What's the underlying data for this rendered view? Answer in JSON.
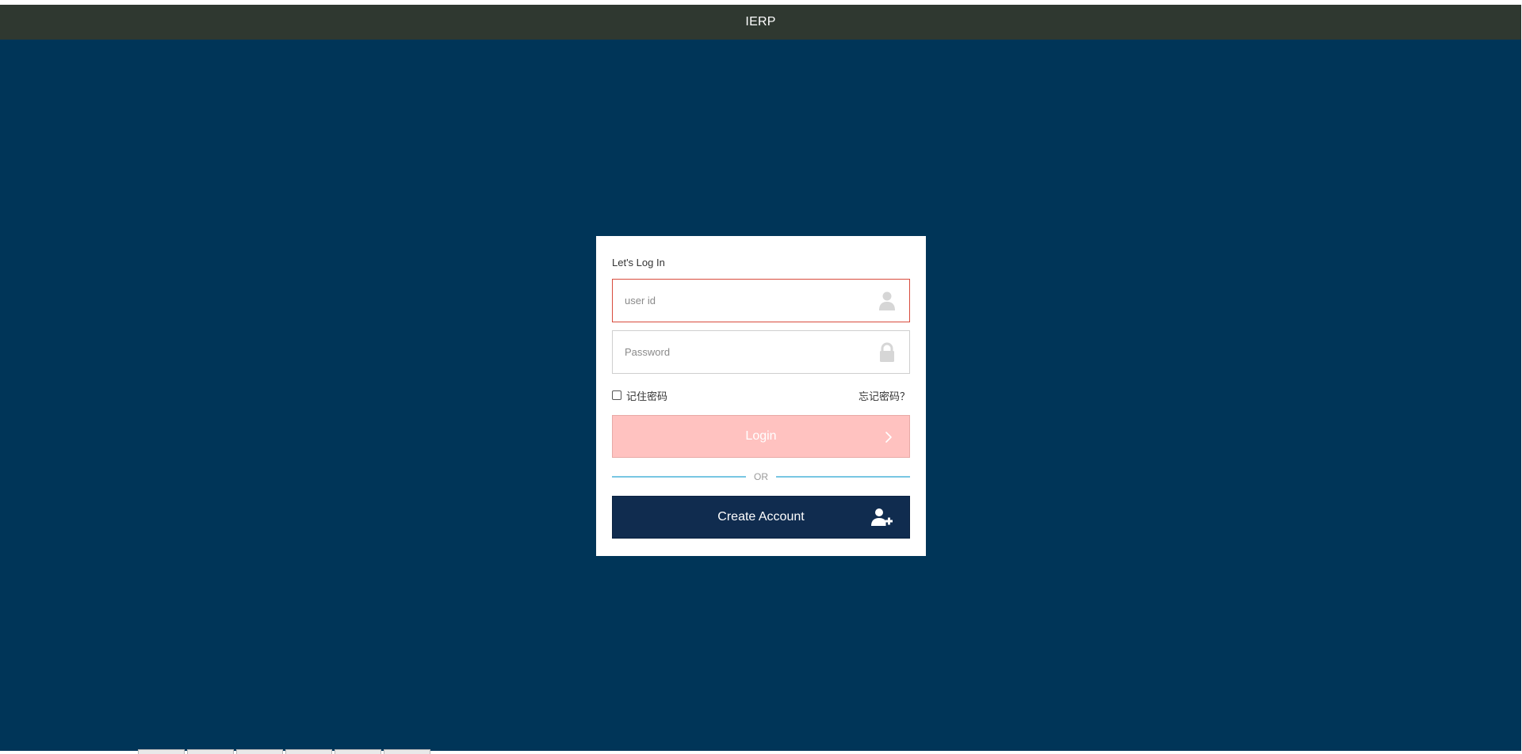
{
  "app": {
    "title": "IERP"
  },
  "login": {
    "heading": "Let's Log In",
    "userid_placeholder": "user id",
    "password_placeholder": "Password",
    "remember_label": "记住密码",
    "forgot_label": "忘记密码？",
    "login_label": "Login",
    "or_label": "OR",
    "create_label": "Create Account"
  },
  "icons": {
    "user": "user-icon",
    "lock": "lock-icon",
    "chevron": "chevron-right-icon",
    "add_user": "user-plus-icon"
  },
  "colors": {
    "header_bg": "#2f3830",
    "page_bg": "#003558",
    "card_bg": "#ffffff",
    "error_border": "#d84b3c",
    "login_bg": "#ffc2c0",
    "divider": "#78c6e3",
    "create_bg": "#102c4f"
  }
}
